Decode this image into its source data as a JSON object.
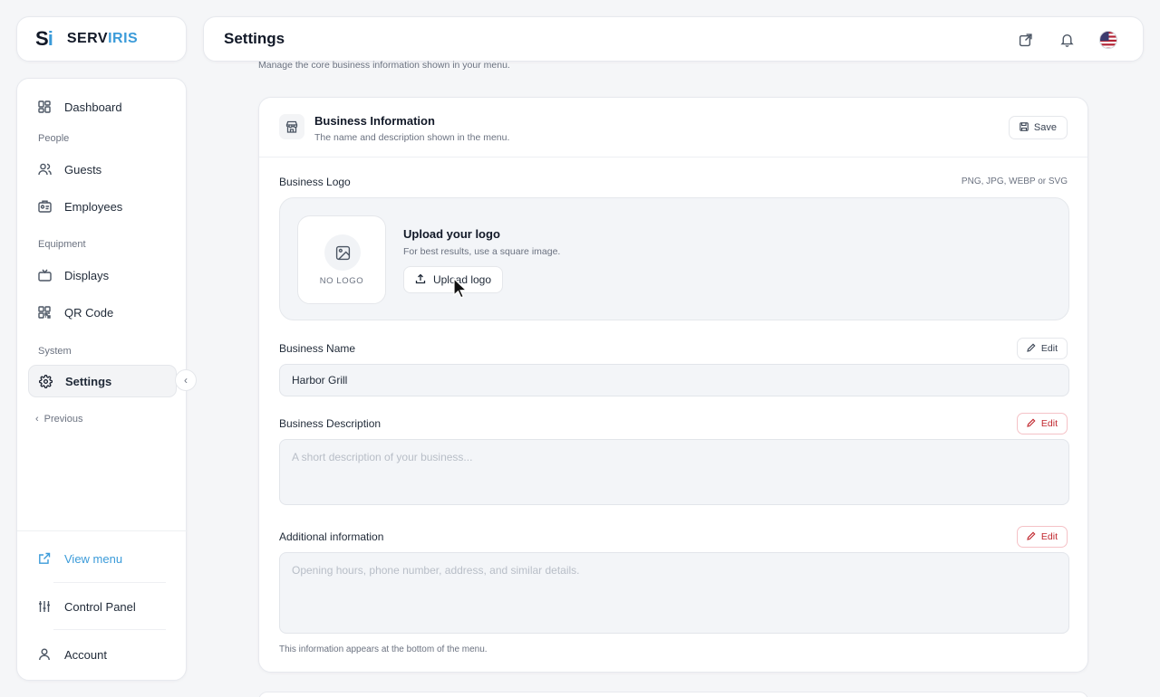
{
  "brand": {
    "mark_s": "S",
    "mark_i": "i",
    "name_prefix": "SERV",
    "name_suffix": "IRIS",
    "accent": "#3b9bd9"
  },
  "header": {
    "title": "Settings",
    "icons": [
      "external-link-icon",
      "bell-icon",
      "us-flag-icon"
    ]
  },
  "page": {
    "subtitle": "Manage the core business information shown in your menu."
  },
  "sidebar": {
    "items": [
      {
        "label": "Dashboard",
        "icon": "dashboard-icon"
      },
      {
        "label": "Guests",
        "icon": "users-icon"
      },
      {
        "label": "Employees",
        "icon": "id-card-icon"
      },
      {
        "label": "Displays",
        "icon": "tv-icon"
      },
      {
        "label": "QR Code",
        "icon": "qr-code-icon"
      },
      {
        "label": "Settings",
        "icon": "gear-icon",
        "active": true
      }
    ],
    "sections": {
      "people": "People",
      "equipment": "Equipment",
      "system": "System"
    },
    "previous": "Previous",
    "bottom": [
      {
        "label": "View menu",
        "icon": "external-link-icon"
      },
      {
        "label": "Control Panel",
        "icon": "sliders-icon"
      },
      {
        "label": "Account",
        "icon": "user-icon"
      }
    ]
  },
  "panel": {
    "title": "Business Information",
    "subtitle": "The name and description shown in the menu.",
    "save_label": "Save",
    "logo": {
      "label": "Business Logo",
      "formats": "PNG, JPG, WEBP or SVG",
      "placeholder": "NO LOGO",
      "upload_title": "Upload your logo",
      "upload_hint": "For best results, use a square image.",
      "upload_button": "Upload logo"
    },
    "name": {
      "label": "Business Name",
      "value": "Harbor Grill",
      "edit": "Edit"
    },
    "description": {
      "label": "Business Description",
      "placeholder": "A short description of your business...",
      "edit": "Edit"
    },
    "additional": {
      "label": "Additional information",
      "placeholder": "Opening hours, phone number, address, and similar details.",
      "edit": "Edit",
      "note": "This information appears at the bottom of the menu."
    }
  }
}
